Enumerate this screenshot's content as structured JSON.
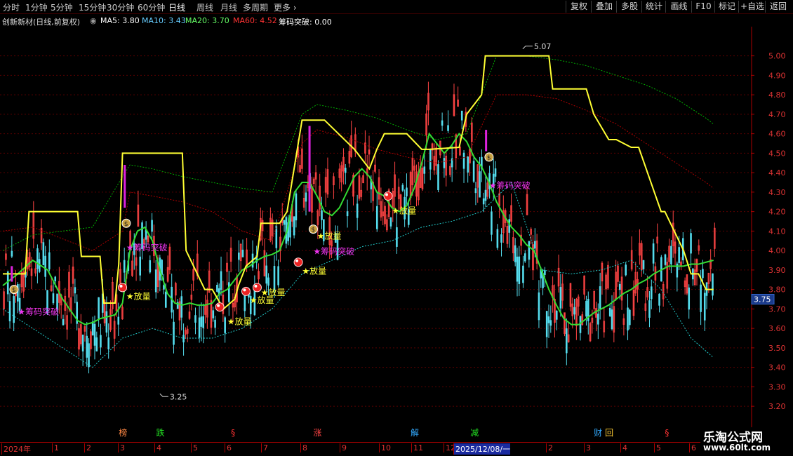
{
  "periods": [
    "分时",
    "1分钟",
    "5分钟",
    "15分钟",
    "30分钟",
    "60分钟",
    "日线",
    "周线",
    "月线",
    "多周期",
    "更多"
  ],
  "active_period": "日线",
  "toolbar": [
    "复权",
    "叠加",
    "多股",
    "统计",
    "画线",
    "F10",
    "标记",
    "+自选",
    "返回"
  ],
  "stock_title": "创新新材(日线,前复权)",
  "indicators": [
    {
      "label": "MA5: 3.80",
      "color": "#ffffff"
    },
    {
      "label": "MA10: 3.43",
      "color": "#66ccff"
    },
    {
      "label": "MA20: 3.70",
      "color": "#66ff66"
    },
    {
      "label": "MA60: 4.52",
      "color": "#ff3333"
    },
    {
      "label": "筹码突破: 0.00",
      "color": "#ffffff"
    }
  ],
  "chart_data": {
    "type": "line",
    "title": "创新新材(日线,前复权)",
    "ylim": [
      3.15,
      5.15
    ],
    "y_ticks": [
      "5.00",
      "4.90",
      "4.80",
      "4.70",
      "4.60",
      "4.50",
      "4.40",
      "4.30",
      "4.20",
      "4.10",
      "4.00",
      "3.90",
      "3.80",
      "3.70",
      "3.60",
      "3.50",
      "3.40",
      "3.30",
      "3.20"
    ],
    "current_price": "3.75",
    "max_label": "5.07",
    "min_label": "3.25",
    "x_months": [
      "2024年",
      "1",
      "2",
      "3",
      "4",
      "5",
      "6",
      "7",
      "8",
      "9",
      "10",
      "11",
      "12",
      "2025/12/08/一",
      "2",
      "3",
      "4",
      "5",
      "6"
    ],
    "x_range": [
      0,
      100
    ],
    "series": [
      {
        "name": "",
        "color": "#ffff33",
        "x": [
          0,
          3,
          3.5,
          10,
          10.5,
          13,
          13.5,
          15,
          15.5,
          16,
          17,
          17.5,
          24,
          24.5,
          27,
          28,
          29.5,
          31,
          31.5,
          32.5,
          34,
          34.5,
          37,
          38,
          40,
          40.5,
          41,
          41.5,
          43,
          47,
          49,
          50,
          51,
          51.5,
          53,
          54,
          56,
          57,
          61,
          62,
          64,
          64.5,
          65,
          66,
          73,
          73.5,
          78,
          79,
          81,
          82,
          84,
          85,
          88,
          88.5,
          91,
          92,
          93,
          94,
          95
        ],
        "values": [
          3.88,
          3.88,
          4.2,
          4.2,
          3.97,
          3.97,
          3.73,
          3.73,
          3.93,
          4.5,
          4.5,
          4.5,
          4.5,
          4.0,
          3.8,
          3.8,
          3.7,
          3.75,
          3.82,
          3.92,
          3.97,
          4.14,
          4.14,
          4.2,
          4.67,
          4.67,
          4.67,
          4.67,
          4.67,
          4.52,
          4.42,
          4.52,
          4.6,
          4.6,
          4.6,
          4.6,
          4.52,
          4.52,
          4.53,
          4.7,
          4.8,
          5.0,
          5.0,
          5.0,
          5.0,
          4.83,
          4.83,
          4.7,
          4.57,
          4.57,
          4.53,
          4.53,
          4.2,
          4.2,
          4.0,
          3.88,
          3.88,
          3.8,
          3.8
        ]
      },
      {
        "name": "",
        "color": "#33dd33",
        "x": [
          0,
          2,
          4,
          6,
          8,
          10,
          11,
          12,
          13,
          15,
          16,
          17,
          18,
          19,
          20,
          21,
          22,
          23,
          24,
          25,
          26,
          27,
          28,
          29,
          30,
          31,
          32,
          33,
          34,
          35,
          36,
          37,
          38,
          39,
          40,
          41,
          42,
          43,
          44,
          45,
          46,
          47,
          48,
          49,
          50,
          51,
          52,
          53,
          54,
          55,
          56,
          57,
          58,
          59,
          60,
          61,
          62,
          63,
          64,
          65,
          66,
          67,
          68,
          69,
          70,
          71,
          72,
          73,
          74,
          75,
          76,
          77,
          78,
          79,
          80,
          81,
          82,
          83,
          84,
          85,
          86,
          87,
          88,
          89,
          90,
          91,
          92,
          93,
          94,
          95
        ],
        "values": [
          3.82,
          3.88,
          3.95,
          3.9,
          3.75,
          3.64,
          3.62,
          3.63,
          3.65,
          3.67,
          3.73,
          4.0,
          4.1,
          4.12,
          4.05,
          3.9,
          3.78,
          3.73,
          3.72,
          3.73,
          3.72,
          3.72,
          3.73,
          3.78,
          3.8,
          3.85,
          3.9,
          3.92,
          3.95,
          3.97,
          3.98,
          4.0,
          4.1,
          4.3,
          4.35,
          4.35,
          4.28,
          4.2,
          4.18,
          4.22,
          4.3,
          4.38,
          4.42,
          4.38,
          4.3,
          4.28,
          4.22,
          4.2,
          4.23,
          4.32,
          4.45,
          4.6,
          4.55,
          4.5,
          4.54,
          4.6,
          4.56,
          4.48,
          4.43,
          4.35,
          4.25,
          4.18,
          4.12,
          4.08,
          4.03,
          4.0,
          3.9,
          3.8,
          3.72,
          3.65,
          3.62,
          3.62,
          3.65,
          3.68,
          3.7,
          3.72,
          3.75,
          3.78,
          3.8,
          3.83,
          3.85,
          3.88,
          3.9,
          3.92,
          3.92,
          3.92,
          3.93,
          3.93,
          3.94,
          3.95
        ]
      },
      {
        "name": "",
        "color": "#00aa00",
        "x": [
          0,
          4,
          8,
          12,
          16,
          17,
          20,
          24,
          28,
          32,
          36,
          40,
          42,
          46,
          50,
          54,
          58,
          62,
          66,
          70,
          74,
          78,
          82,
          86,
          90,
          94,
          95
        ],
        "values": [
          4.0,
          4.08,
          4.1,
          4.12,
          4.38,
          4.44,
          4.42,
          4.38,
          4.35,
          4.32,
          4.3,
          4.7,
          4.75,
          4.72,
          4.68,
          4.62,
          4.57,
          4.6,
          5.0,
          5.0,
          4.98,
          4.95,
          4.9,
          4.85,
          4.78,
          4.68,
          4.65
        ]
      },
      {
        "name": "",
        "color": "#aa0000",
        "x": [
          0,
          4,
          8,
          12,
          16,
          17,
          20,
          24,
          28,
          32,
          36,
          40,
          42,
          46,
          50,
          54,
          58,
          62,
          66,
          70,
          74,
          78,
          82,
          86,
          90,
          94,
          95
        ],
        "values": [
          4.1,
          4.12,
          4.06,
          4.0,
          4.1,
          4.3,
          4.28,
          4.25,
          4.2,
          4.1,
          4.05,
          4.55,
          4.62,
          4.58,
          4.52,
          4.48,
          4.45,
          4.48,
          4.8,
          4.8,
          4.78,
          4.72,
          4.65,
          4.55,
          4.45,
          4.35,
          4.32
        ]
      },
      {
        "name": "",
        "color": "#22cccc",
        "x": [
          0,
          4,
          8,
          12,
          16,
          20,
          24,
          28,
          32,
          36,
          40,
          44,
          48,
          52,
          56,
          60,
          64,
          68,
          72,
          76,
          80,
          84,
          88,
          92,
          95
        ],
        "values": [
          3.7,
          3.6,
          3.5,
          3.4,
          3.55,
          3.6,
          3.55,
          3.55,
          3.6,
          3.7,
          3.88,
          3.95,
          4.02,
          4.05,
          4.12,
          4.15,
          4.2,
          4.35,
          3.9,
          3.88,
          3.9,
          3.95,
          3.8,
          3.55,
          3.45
        ]
      }
    ],
    "annotations": [
      {
        "x": 1.5,
        "y": 3.8,
        "text": "",
        "kind": "bag"
      },
      {
        "x": 2,
        "y": 3.67,
        "text": "★筹码突破",
        "kind": "pink"
      },
      {
        "x": 16.5,
        "y": 4.14,
        "text": "",
        "kind": "bag"
      },
      {
        "x": 16.5,
        "y": 4.0,
        "text": "★筹码突破",
        "kind": "pink"
      },
      {
        "x": 16,
        "y": 3.81,
        "text": "",
        "kind": "ball"
      },
      {
        "x": 16.5,
        "y": 3.75,
        "text": "★放量",
        "kind": "yellow"
      },
      {
        "x": 29,
        "y": 3.71,
        "text": "",
        "kind": "ball"
      },
      {
        "x": 30,
        "y": 3.62,
        "text": "★放量",
        "kind": "yellow"
      },
      {
        "x": 32.5,
        "y": 3.79,
        "text": "",
        "kind": "ball"
      },
      {
        "x": 34,
        "y": 3.81,
        "text": "",
        "kind": "ball"
      },
      {
        "x": 33,
        "y": 3.73,
        "text": "★放量",
        "kind": "yellow"
      },
      {
        "x": 34.5,
        "y": 3.77,
        "text": "★放量",
        "kind": "yellow"
      },
      {
        "x": 39.5,
        "y": 3.94,
        "text": "",
        "kind": "ball"
      },
      {
        "x": 40,
        "y": 3.88,
        "text": "★放量",
        "kind": "yellow"
      },
      {
        "x": 41.5,
        "y": 4.11,
        "text": "",
        "kind": "bag"
      },
      {
        "x": 41.5,
        "y": 3.98,
        "text": "★筹码突破",
        "kind": "pink"
      },
      {
        "x": 42,
        "y": 4.06,
        "text": "★放量",
        "kind": "yellow"
      },
      {
        "x": 51.5,
        "y": 4.28,
        "text": "",
        "kind": "ball"
      },
      {
        "x": 52,
        "y": 4.19,
        "text": "★放量",
        "kind": "yellow"
      },
      {
        "x": 65,
        "y": 4.48,
        "text": "",
        "kind": "bag"
      },
      {
        "x": 65,
        "y": 4.32,
        "text": "★筹码突破",
        "kind": "pink"
      }
    ],
    "bottom_markers": [
      {
        "x": 15.5,
        "text": "榜",
        "color": "#ff8844"
      },
      {
        "x": 20.5,
        "text": "跌",
        "color": "#22dd22"
      },
      {
        "x": 30.5,
        "text": "§",
        "color": "#ff3333"
      },
      {
        "x": 41.5,
        "text": "涨",
        "color": "#ff4444"
      },
      {
        "x": 54.5,
        "text": "解",
        "color": "#33aaff"
      },
      {
        "x": 62.5,
        "text": "减",
        "color": "#22dd22"
      },
      {
        "x": 79,
        "text": "财",
        "color": "#33aaff"
      },
      {
        "x": 80.5,
        "text": "回",
        "color": "#ffcc33"
      },
      {
        "x": 88.5,
        "text": "§",
        "color": "#ff3333"
      }
    ]
  },
  "watermark": {
    "line1": "乐淘公式网",
    "line2": "www.60lt.com"
  }
}
